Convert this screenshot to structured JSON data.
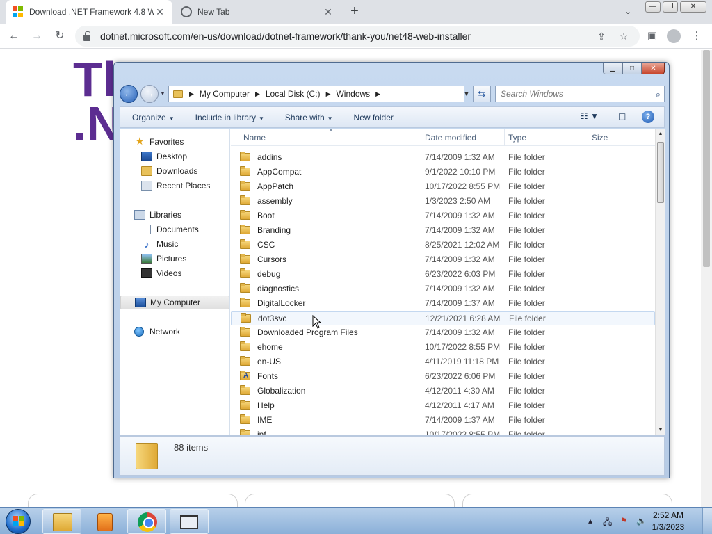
{
  "browser": {
    "tabs": [
      {
        "title": "Download .NET Framework 4.8 W",
        "active": true
      },
      {
        "title": "New Tab",
        "active": false
      }
    ],
    "url": "dotnet.microsoft.com/en-us/download/dotnet-framework/thank-you/net48-web-installer",
    "page_heading_line1": "Th",
    "page_heading_line2": ".N"
  },
  "explorer": {
    "breadcrumbs": [
      "My Computer",
      "Local Disk (C:)",
      "Windows"
    ],
    "search_placeholder": "Search Windows",
    "commands": {
      "organize": "Organize",
      "include_in_library": "Include in library",
      "share_with": "Share with",
      "new_folder": "New folder"
    },
    "nav": {
      "favorites": "Favorites",
      "desktop": "Desktop",
      "downloads": "Downloads",
      "recent_places": "Recent Places",
      "libraries": "Libraries",
      "documents": "Documents",
      "music": "Music",
      "pictures": "Pictures",
      "videos": "Videos",
      "my_computer": "My Computer",
      "network": "Network"
    },
    "columns": {
      "name": "Name",
      "date": "Date modified",
      "type": "Type",
      "size": "Size"
    },
    "files": [
      {
        "name": "addins",
        "date": "7/14/2009 1:32 AM",
        "type": "File folder"
      },
      {
        "name": "AppCompat",
        "date": "9/1/2022 10:10 PM",
        "type": "File folder"
      },
      {
        "name": "AppPatch",
        "date": "10/17/2022 8:55 PM",
        "type": "File folder"
      },
      {
        "name": "assembly",
        "date": "1/3/2023 2:50 AM",
        "type": "File folder"
      },
      {
        "name": "Boot",
        "date": "7/14/2009 1:32 AM",
        "type": "File folder"
      },
      {
        "name": "Branding",
        "date": "7/14/2009 1:32 AM",
        "type": "File folder"
      },
      {
        "name": "CSC",
        "date": "8/25/2021 12:02 AM",
        "type": "File folder"
      },
      {
        "name": "Cursors",
        "date": "7/14/2009 1:32 AM",
        "type": "File folder"
      },
      {
        "name": "debug",
        "date": "6/23/2022 6:03 PM",
        "type": "File folder"
      },
      {
        "name": "diagnostics",
        "date": "7/14/2009 1:32 AM",
        "type": "File folder"
      },
      {
        "name": "DigitalLocker",
        "date": "7/14/2009 1:37 AM",
        "type": "File folder"
      },
      {
        "name": "dot3svc",
        "date": "12/21/2021 6:28 AM",
        "type": "File folder"
      },
      {
        "name": "Downloaded Program Files",
        "date": "7/14/2009 1:32 AM",
        "type": "File folder"
      },
      {
        "name": "ehome",
        "date": "10/17/2022 8:55 PM",
        "type": "File folder"
      },
      {
        "name": "en-US",
        "date": "4/11/2019 11:18 PM",
        "type": "File folder"
      },
      {
        "name": "Fonts",
        "date": "6/23/2022 6:06 PM",
        "type": "File folder"
      },
      {
        "name": "Globalization",
        "date": "4/12/2011 4:30 AM",
        "type": "File folder"
      },
      {
        "name": "Help",
        "date": "4/12/2011 4:17 AM",
        "type": "File folder"
      },
      {
        "name": "IME",
        "date": "7/14/2009 1:37 AM",
        "type": "File folder"
      },
      {
        "name": "inf",
        "date": "10/17/2022 8:55 PM",
        "type": "File folder"
      }
    ],
    "item_count": "88 items"
  },
  "taskbar": {
    "time": "2:52 AM",
    "date": "1/3/2023"
  },
  "colors": {
    "dotnet_purple": "#5c2d91",
    "explorer_frame": "#c8daf0",
    "taskbar": "#8bb0d8"
  }
}
